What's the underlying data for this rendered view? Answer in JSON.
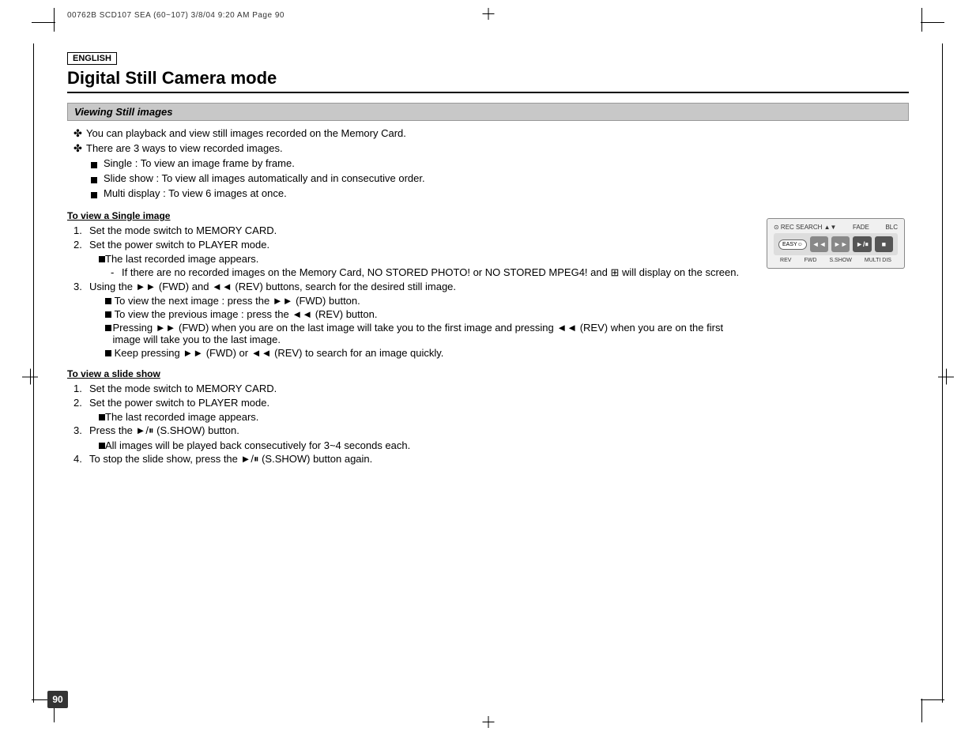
{
  "fileInfo": "00762B SCD107 SEA (60~107)  3/8/04 9:20 AM  Page 90",
  "englishLabel": "ENGLISH",
  "pageTitle": "Digital Still Camera mode",
  "sectionHeader": "Viewing Still images",
  "bullets": [
    "You can playback and view still images recorded on the Memory Card.",
    "There are 3 ways to view recorded images."
  ],
  "subBullets": [
    "Single : To view an image frame by frame.",
    "Slide show : To view all images automatically and in consecutive order.",
    "Multi display : To view 6 images at once."
  ],
  "singleImageSection": {
    "heading": "To view a Single image",
    "steps": [
      "Set the mode switch to MEMORY CARD.",
      "Set the power switch to PLAYER mode.",
      "Using the ►► (FWD) and ◄◄ (REV) buttons, search for the desired still image.",
      "Keep pressing ►► (FWD) or ◄◄ (REV) to search for an image quickly."
    ],
    "step2sub": [
      "The last recorded image appears.",
      "If there are no recorded images on the Memory Card, NO STORED PHOTO! or NO STORED MPEG4! and ⊞ will display on the screen."
    ],
    "step3sub": [
      "To view the next image : press the ►► (FWD) button.",
      "To view the previous image : press the ◄◄ (REV) button.",
      "Pressing ►► (FWD) when you are on the last image will take you to the first image and pressing ◄◄ (REV) when you are on the first image will take you to the last image."
    ]
  },
  "slideShowSection": {
    "heading": "To view a slide show",
    "steps": [
      "Set the mode switch to MEMORY CARD.",
      "Set the power switch to PLAYER mode.",
      "Press the ►/⏸ (S.SHOW) button.",
      "To stop the slide show, press the ►/⏸ (S.SHOW) button again."
    ],
    "step2sub": [
      "The last recorded image appears."
    ],
    "step3sub": [
      "All images will be played back consecutively for 3~4 seconds each."
    ]
  },
  "cameraPanel": {
    "topLabels": [
      "REC SEARCH ▲▼",
      "FADE",
      "BLC"
    ],
    "easyLabel": "EASY☺",
    "buttons": [
      "◄◄",
      "►►",
      "►/⏸",
      "■"
    ],
    "bottomLabels": [
      "REV",
      "FWD",
      "S.SHOW",
      "MULTI DIS"
    ]
  },
  "pageNumber": "90"
}
